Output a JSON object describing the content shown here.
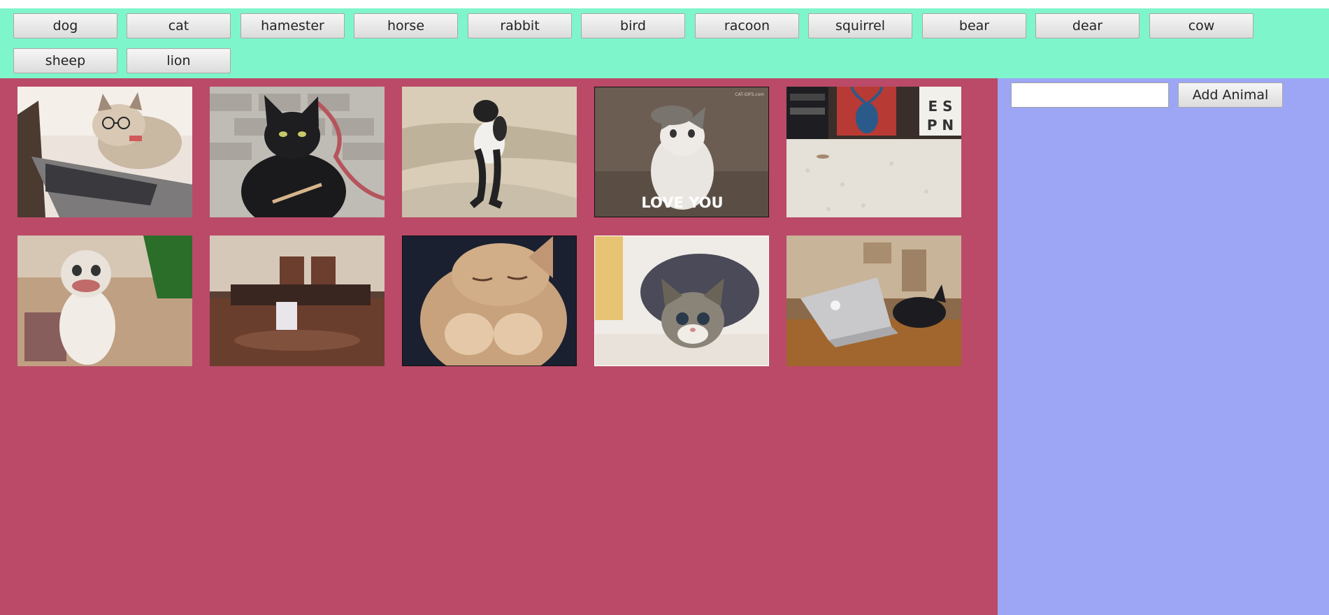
{
  "buttons": {
    "labels": [
      "dog",
      "cat",
      "hamester",
      "horse",
      "rabbit",
      "bird",
      "racoon",
      "squirrel",
      "bear",
      "dear",
      "cow",
      "sheep",
      "lion"
    ]
  },
  "form": {
    "input_value": "",
    "input_placeholder": "",
    "add_label": "Add Animal"
  },
  "gifs": [
    {
      "subject": "cat-with-glasses-at-laptop"
    },
    {
      "subject": "black-cat-filing-nails"
    },
    {
      "subject": "cat-standing-on-beach"
    },
    {
      "subject": "cat-jumping",
      "caption": "LOVE YOU",
      "watermark": "CAT-GIFS.com"
    },
    {
      "subject": "living-room-floor",
      "watermark_lines": [
        "E S",
        "P N"
      ]
    },
    {
      "subject": "scottish-fold-cat-lips"
    },
    {
      "subject": "cat-on-dining-table"
    },
    {
      "subject": "sleepy-ginger-cat"
    },
    {
      "subject": "crouching-tabby-cat"
    },
    {
      "subject": "black-cat-with-laptop"
    }
  ],
  "colors": {
    "button_bar": "#7ff5cb",
    "gif_area": "#ba4a68",
    "side_panel": "#9ca6f5"
  }
}
